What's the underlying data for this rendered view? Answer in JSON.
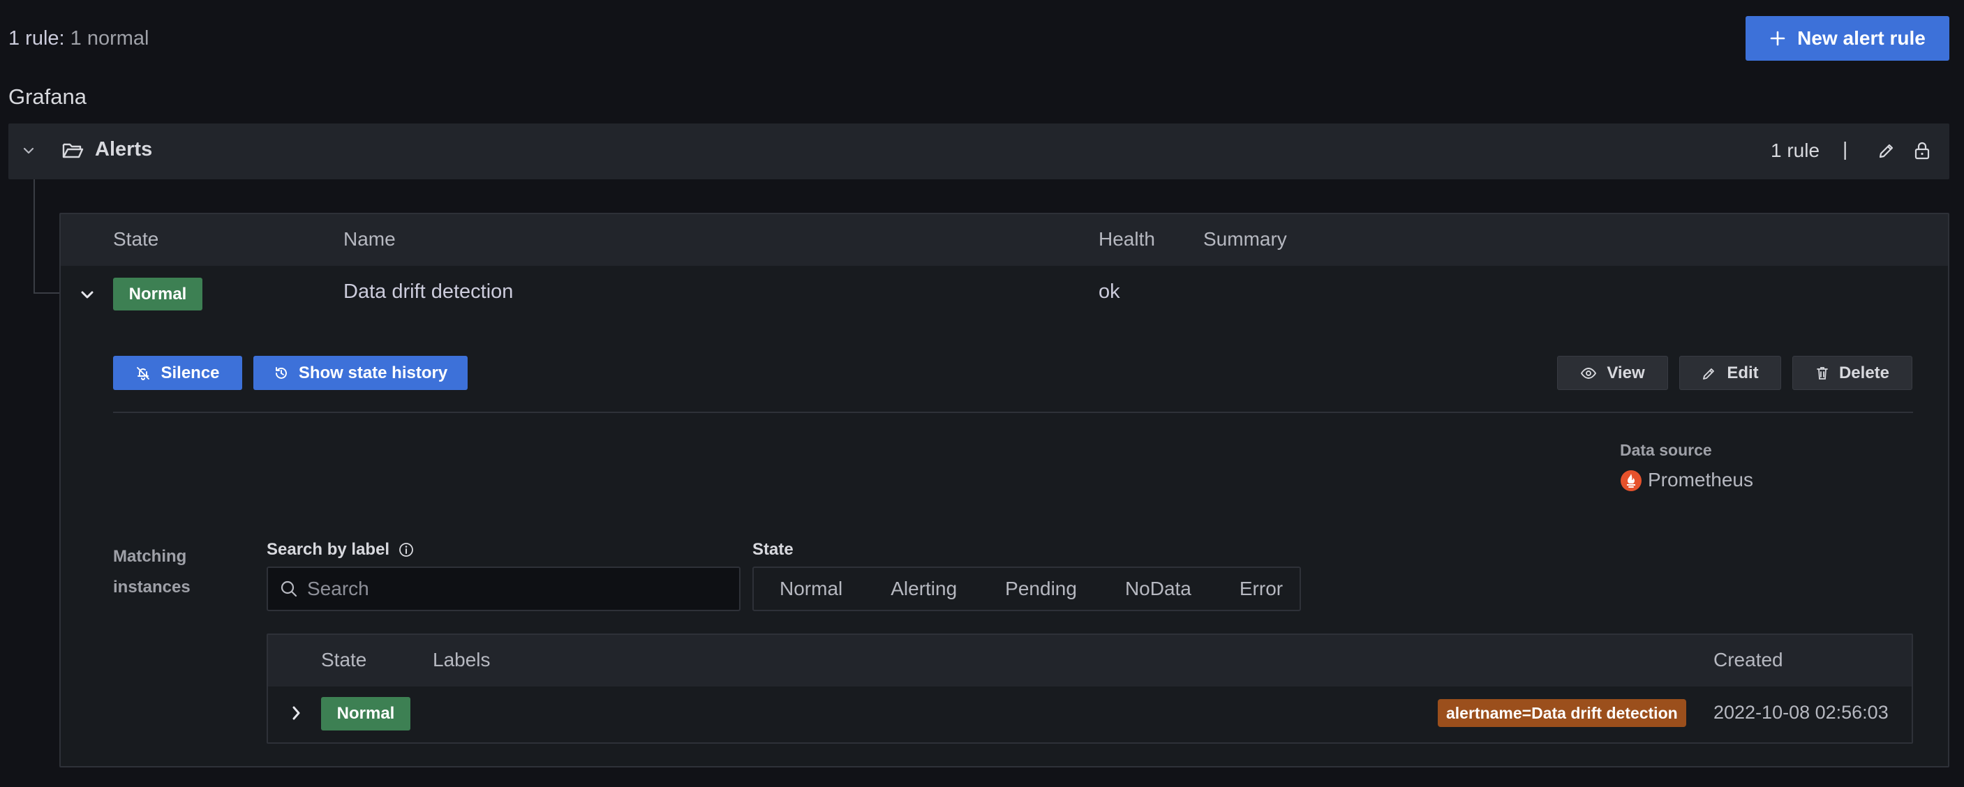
{
  "header": {
    "rule_count_label": "1 rule:",
    "rule_count_detail": "1 normal",
    "new_rule_label": "New alert rule"
  },
  "namespace": {
    "title": "Grafana",
    "folder": {
      "name": "Alerts",
      "rule_count": "1 rule",
      "separator": "|"
    }
  },
  "rules_table": {
    "columns": [
      "State",
      "Name",
      "Health",
      "Summary"
    ],
    "rows": [
      {
        "state": "Normal",
        "name": "Data drift detection",
        "health": "ok",
        "summary": ""
      }
    ]
  },
  "rule_details": {
    "actions": {
      "silence": "Silence",
      "history": "Show state history",
      "view": "View",
      "edit": "Edit",
      "delete": "Delete"
    },
    "data_source": {
      "label": "Data source",
      "value": "Prometheus"
    },
    "matching_instances": {
      "line1": "Matching",
      "line2": "instances"
    },
    "search": {
      "label": "Search by label",
      "placeholder": "Search"
    },
    "state_filter": {
      "label": "State",
      "options": [
        "Normal",
        "Alerting",
        "Pending",
        "NoData",
        "Error"
      ]
    },
    "instances_table": {
      "columns": [
        "State",
        "Labels",
        "Created"
      ],
      "rows": [
        {
          "state": "Normal",
          "label": "alertname=Data drift detection",
          "created": "2022-10-08 02:56:03"
        }
      ]
    }
  },
  "colors": {
    "background": "#111217",
    "primary": "#3d71d9",
    "normal_state": "#3d8053",
    "label_tag": "#9b4f1c",
    "prometheus": "#e6522c"
  }
}
